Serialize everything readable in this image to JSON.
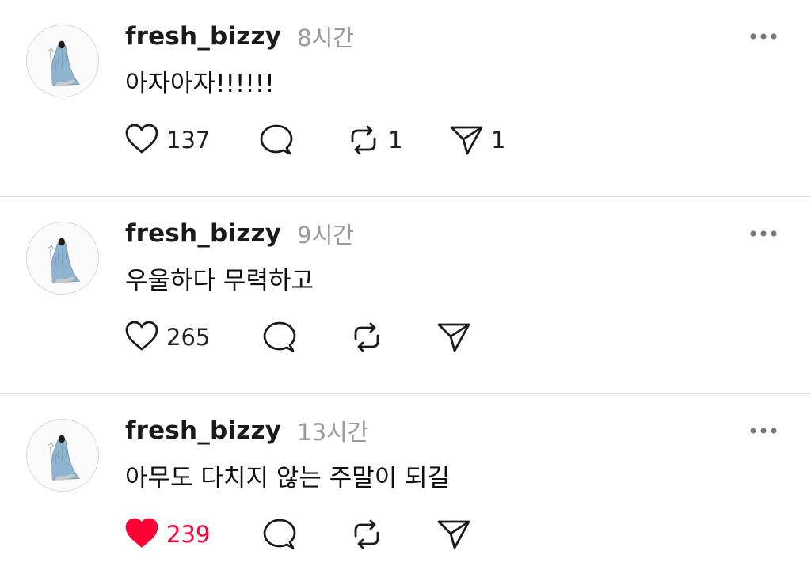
{
  "posts": [
    {
      "username": "fresh_bizzy",
      "time": "8시간",
      "text": "아자아자!!!!!!",
      "liked": false,
      "likes": "137",
      "replies": "",
      "reposts": "1",
      "shares": "1"
    },
    {
      "username": "fresh_bizzy",
      "time": "9시간",
      "text": "우울하다 무력하고",
      "liked": false,
      "likes": "265",
      "replies": "",
      "reposts": "",
      "shares": ""
    },
    {
      "username": "fresh_bizzy",
      "time": "13시간",
      "text": "아무도 다치지 않는 주말이 되길",
      "liked": true,
      "likes": "239",
      "replies": "",
      "reposts": "",
      "shares": ""
    }
  ],
  "icons": {
    "avatar": "avatar-illustration-icon",
    "like": "heart-icon",
    "reply": "speech-bubble-icon",
    "repost": "repost-arrows-icon",
    "share": "paper-plane-icon",
    "more": "more-dots-icon"
  },
  "colors": {
    "like_active": "#ff0034",
    "timestamp": "#9a9a9a",
    "divider": "#dbdbdb"
  }
}
